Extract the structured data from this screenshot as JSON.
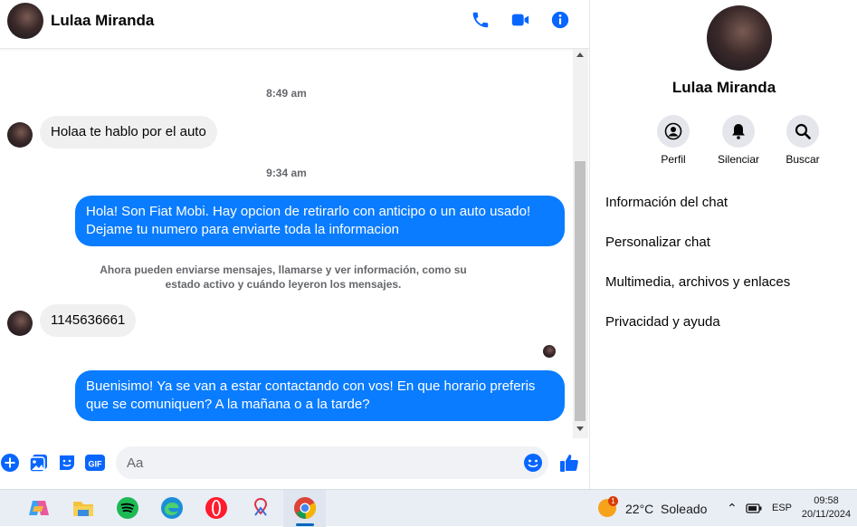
{
  "header": {
    "contact_name": "Lulaa Miranda"
  },
  "messages": {
    "time_1": "8:49 am",
    "incoming_1": "Holaa te hablo por el auto",
    "time_2": "9:34 am",
    "outgoing_1": "Hola! Son Fiat Mobi. Hay opcion de retirarlo con anticipo o un auto usado! Dejame tu numero para enviarte toda la informacion",
    "notice": "Ahora pueden enviarse mensajes, llamarse y ver información, como su estado activo y cuándo leyeron los mensajes.",
    "incoming_2": "1145636661",
    "outgoing_2": "Buenisimo! Ya se van a estar contactando con vos! En que horario preferis que se comuniquen? A la mañana o a la tarde?"
  },
  "composer": {
    "placeholder": "Aa",
    "gif_label": "GIF"
  },
  "sidebar": {
    "contact_name": "Lulaa Miranda",
    "actions": [
      {
        "label": "Perfil",
        "icon": "profile-icon"
      },
      {
        "label": "Silenciar",
        "icon": "bell-icon"
      },
      {
        "label": "Buscar",
        "icon": "search-icon"
      }
    ],
    "menu": [
      "Información del chat",
      "Personalizar chat",
      "Multimedia, archivos y enlaces",
      "Privacidad y ayuda"
    ]
  },
  "taskbar": {
    "weather_badge": "1",
    "weather": "22°C  Soleado",
    "language": "ESP",
    "time": "09:58",
    "date": "20/11/2024"
  },
  "colors": {
    "accent": "#0a7cff",
    "icon_blue": "#0866ff",
    "incoming_bg": "#f0f0f0"
  }
}
